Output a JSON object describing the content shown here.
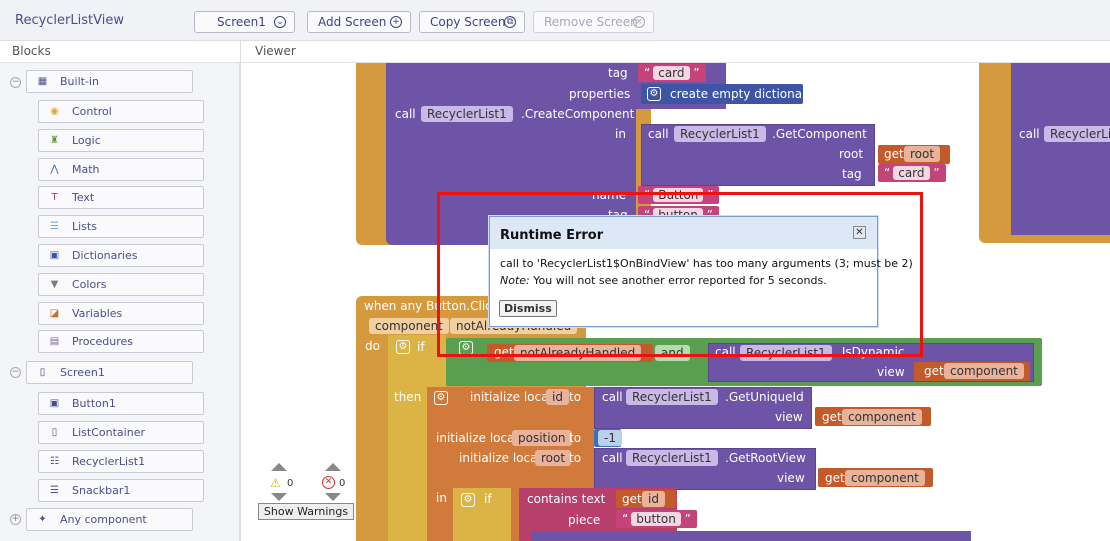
{
  "app": {
    "project_name": "RecyclerListView"
  },
  "toolbar": {
    "screen_select": "Screen1",
    "add_screen": "Add Screen",
    "copy_screen": "Copy Screen",
    "remove_screen": "Remove Screen"
  },
  "panels": {
    "blocks_title": "Blocks",
    "viewer_title": "Viewer"
  },
  "tree": {
    "builtin": "Built-in",
    "builtin_items": [
      {
        "label": "Control",
        "icon": "control-icon",
        "color": "#e5a33a"
      },
      {
        "label": "Logic",
        "icon": "logic-icon",
        "color": "#5b9a3c"
      },
      {
        "label": "Math",
        "icon": "math-icon",
        "color": "#3b6fb8"
      },
      {
        "label": "Text",
        "icon": "text-icon",
        "color": "#b33b6b"
      },
      {
        "label": "Lists",
        "icon": "lists-icon",
        "color": "#6aa7d8"
      },
      {
        "label": "Dictionaries",
        "icon": "dictionaries-icon",
        "color": "#3e55a6"
      },
      {
        "label": "Colors",
        "icon": "colors-icon",
        "color": "#7b7b7b"
      },
      {
        "label": "Variables",
        "icon": "variables-icon",
        "color": "#d06a2c"
      },
      {
        "label": "Procedures",
        "icon": "procedures-icon",
        "color": "#7b5da9"
      }
    ],
    "screen": "Screen1",
    "screen_items": [
      {
        "label": "Button1",
        "icon": "button-icon"
      },
      {
        "label": "ListContainer",
        "icon": "listcontainer-icon"
      },
      {
        "label": "RecyclerList1",
        "icon": "recyclerlist-icon"
      },
      {
        "label": "Snackbar1",
        "icon": "snackbar-icon"
      }
    ],
    "any_component": "Any component"
  },
  "blocks": {
    "tag_label": "tag",
    "tag_value": "card",
    "properties_label": "properties",
    "create_empty_dict": "create empty dictionary",
    "call": "call",
    "recycler": "RecyclerList1",
    "create_component": ".CreateComponent",
    "in_label": "in",
    "get_component": ".GetComponent",
    "root_label": "root",
    "get": "get",
    "root_var": "root",
    "tag2_value": "card",
    "name_label": "name",
    "name_value": "Button",
    "tag3_value": "button",
    "when_click": "when any Button.Click",
    "component_label": "component",
    "not_handled": "notAlreadyHandled",
    "do_label": "do",
    "if_label": "if",
    "and_label": "and",
    "not_handled_get": "notAlreadyHandled",
    "is_dynamic": ".IsDynamic",
    "view_label": "view",
    "component_var": "component",
    "then_label": "then",
    "init_local": "initialize local",
    "id_var": "id",
    "to_label": "to",
    "get_unique_id": ".GetUniqueId",
    "position_var": "position",
    "neg_one": "-1",
    "get_root_view": ".GetRootView",
    "contains_text": "contains text",
    "piece_label": "piece",
    "button_value": "button",
    "right_call": "call",
    "right_recycler": "RecyclerLis"
  },
  "dialog": {
    "title": "Runtime Error",
    "message": "call to 'RecyclerList1$OnBindView' has too many arguments (3; must be 2)",
    "note_label": "Note:",
    "note_text": " You will not see another error reported for 5 seconds.",
    "dismiss": "Dismiss"
  },
  "warnings": {
    "warn_count": "0",
    "error_count": "0",
    "show_warnings": "Show Warnings"
  }
}
